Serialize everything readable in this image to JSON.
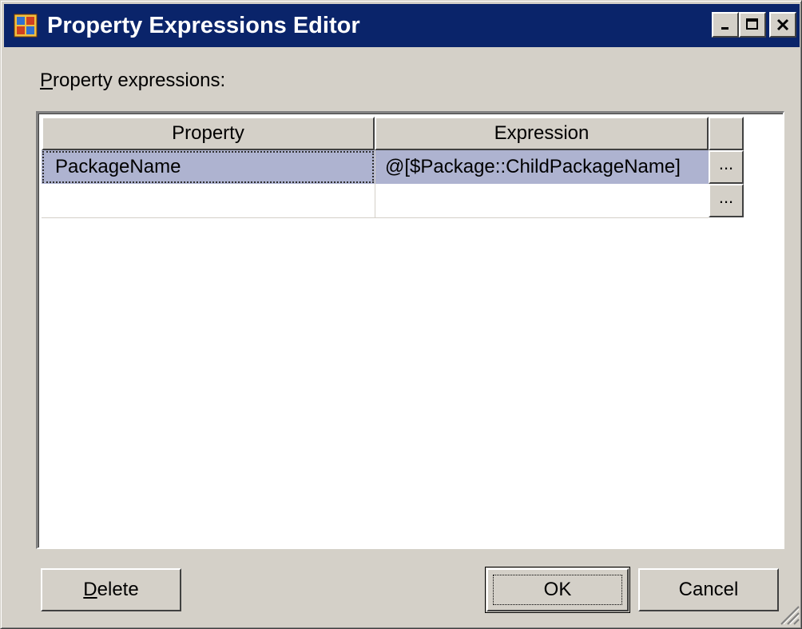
{
  "window": {
    "title": "Property Expressions Editor"
  },
  "label": {
    "mnemonic": "P",
    "rest": "roperty expressions:"
  },
  "grid": {
    "columns": [
      "Property",
      "Expression",
      ""
    ],
    "rows": [
      {
        "property": "PackageName",
        "expression": "@[$Package::ChildPackageName]",
        "button": "..."
      },
      {
        "property": "",
        "expression": "",
        "button": "..."
      }
    ]
  },
  "buttons": {
    "delete": {
      "mnemonic": "D",
      "rest": "elete"
    },
    "ok": "OK",
    "cancel": "Cancel"
  },
  "colors": {
    "titlebar": "#0a246a",
    "selected_row": "#aeb3d0",
    "face": "#d4d0c8"
  }
}
